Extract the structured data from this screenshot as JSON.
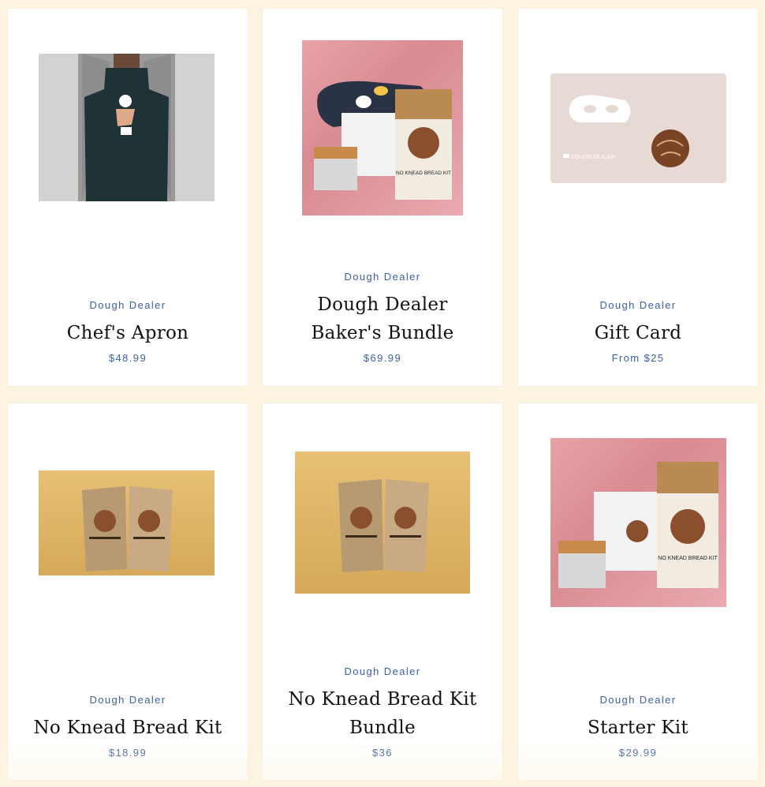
{
  "products": [
    {
      "vendor": "Dough Dealer",
      "title": "Chef's Apron",
      "price": "$48.99",
      "image": "apron-photo"
    },
    {
      "vendor": "Dough Dealer",
      "title": "Dough Dealer Baker's Bundle",
      "title_lines": [
        "Dough Dealer",
        "Baker's Bundle"
      ],
      "price": "$69.99",
      "image": "bundle-photo"
    },
    {
      "vendor": "Dough Dealer",
      "title": "Gift Card",
      "price": "From $25",
      "image": "gift-card-image"
    },
    {
      "vendor": "Dough Dealer",
      "title": "No Knead Bread Kit",
      "price": "$18.99",
      "image": "bread-kit-photo"
    },
    {
      "vendor": "Dough Dealer",
      "title": "No Knead Bread Kit Bundle",
      "title_lines": [
        "No Knead Bread Kit",
        "Bundle"
      ],
      "price": "$36",
      "image": "bread-kit-bundle-photo"
    },
    {
      "vendor": "Dough Dealer",
      "title": "Starter Kit",
      "price": "$29.99",
      "image": "starter-kit-photo"
    }
  ],
  "product_text": {
    "bag_brand": "DOUGH DEALER",
    "bag_label": "NO KNEAD BREAD KIT"
  },
  "colors": {
    "page_background": "#fcf3e0",
    "card_background": "#ffffff",
    "vendor_text": "#3b5fa8",
    "title_text": "#111111"
  }
}
